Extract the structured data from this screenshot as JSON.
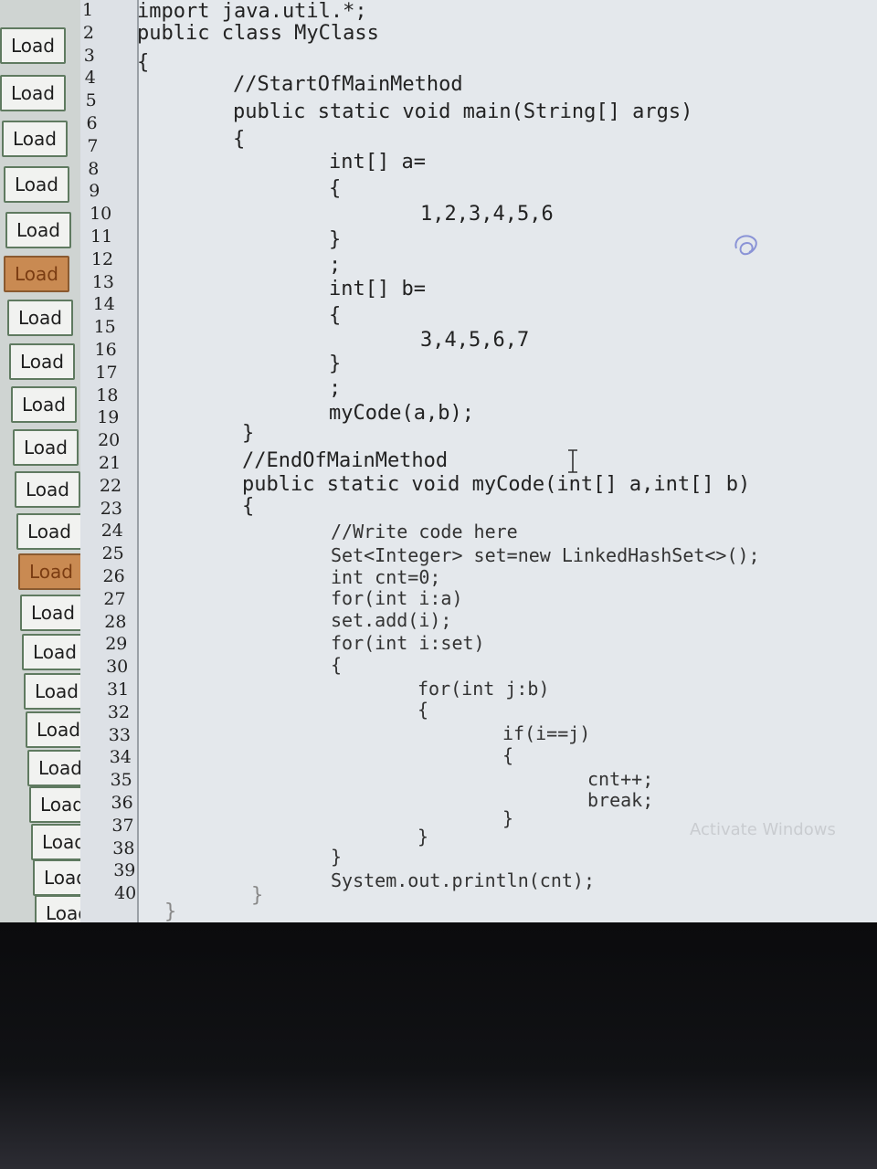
{
  "load_buttons": [
    {
      "label": "Load"
    },
    {
      "label": "Load"
    },
    {
      "label": "Load"
    },
    {
      "label": "Load"
    },
    {
      "label": "Load"
    },
    {
      "label": "Load",
      "active": true
    },
    {
      "label": "Load"
    },
    {
      "label": "Load"
    },
    {
      "label": "Load"
    },
    {
      "label": "Load"
    },
    {
      "label": "Load"
    },
    {
      "label": "Load"
    },
    {
      "label": "Load",
      "active": true
    },
    {
      "label": "Load"
    },
    {
      "label": "Load"
    },
    {
      "label": "Load"
    },
    {
      "label": "Load"
    },
    {
      "label": "Load"
    },
    {
      "label": "Load"
    },
    {
      "label": "Load"
    },
    {
      "label": "Load"
    },
    {
      "label": "Load"
    }
  ],
  "line_numbers": [
    "1",
    "2",
    "3",
    "4",
    "5",
    "6",
    "7",
    "8",
    "9",
    "10",
    "11",
    "12",
    "13",
    "14",
    "15",
    "16",
    "17",
    "18",
    "19",
    "20",
    "21",
    "22",
    "23",
    "24",
    "25",
    "26",
    "27",
    "28",
    "29",
    "30",
    "31",
    "32",
    "33",
    "34",
    "35",
    "36",
    "37",
    "38",
    "39",
    "40"
  ],
  "code_lines": [
    "import java.util.*;",
    "public class MyClass",
    "{",
    "//StartOfMainMethod",
    "public static void main(String[] args)",
    "{",
    "int[] a=",
    "{",
    "1,2,3,4,5,6",
    "}",
    ";",
    "int[] b=",
    "{",
    "3,4,5,6,7",
    "}",
    ";",
    "myCode(a,b);",
    "}",
    "//EndOfMainMethod",
    "public static void myCode(int[] a,int[] b)",
    "{",
    "//Write code here",
    "Set<Integer> set=new LinkedHashSet<>();",
    "int cnt=0;",
    "for(int i:a)",
    "set.add(i);",
    "for(int i:set)",
    "{",
    "for(int j:b)",
    "{",
    "if(i==j)",
    "{",
    "cnt++;",
    "break;",
    "}",
    "}",
    "}",
    "System.out.println(cnt);",
    "}",
    "}"
  ],
  "watermark": "Activate Windows",
  "icons": {
    "cursor": "text-cursor-icon",
    "doodle": "doodle-icon"
  }
}
